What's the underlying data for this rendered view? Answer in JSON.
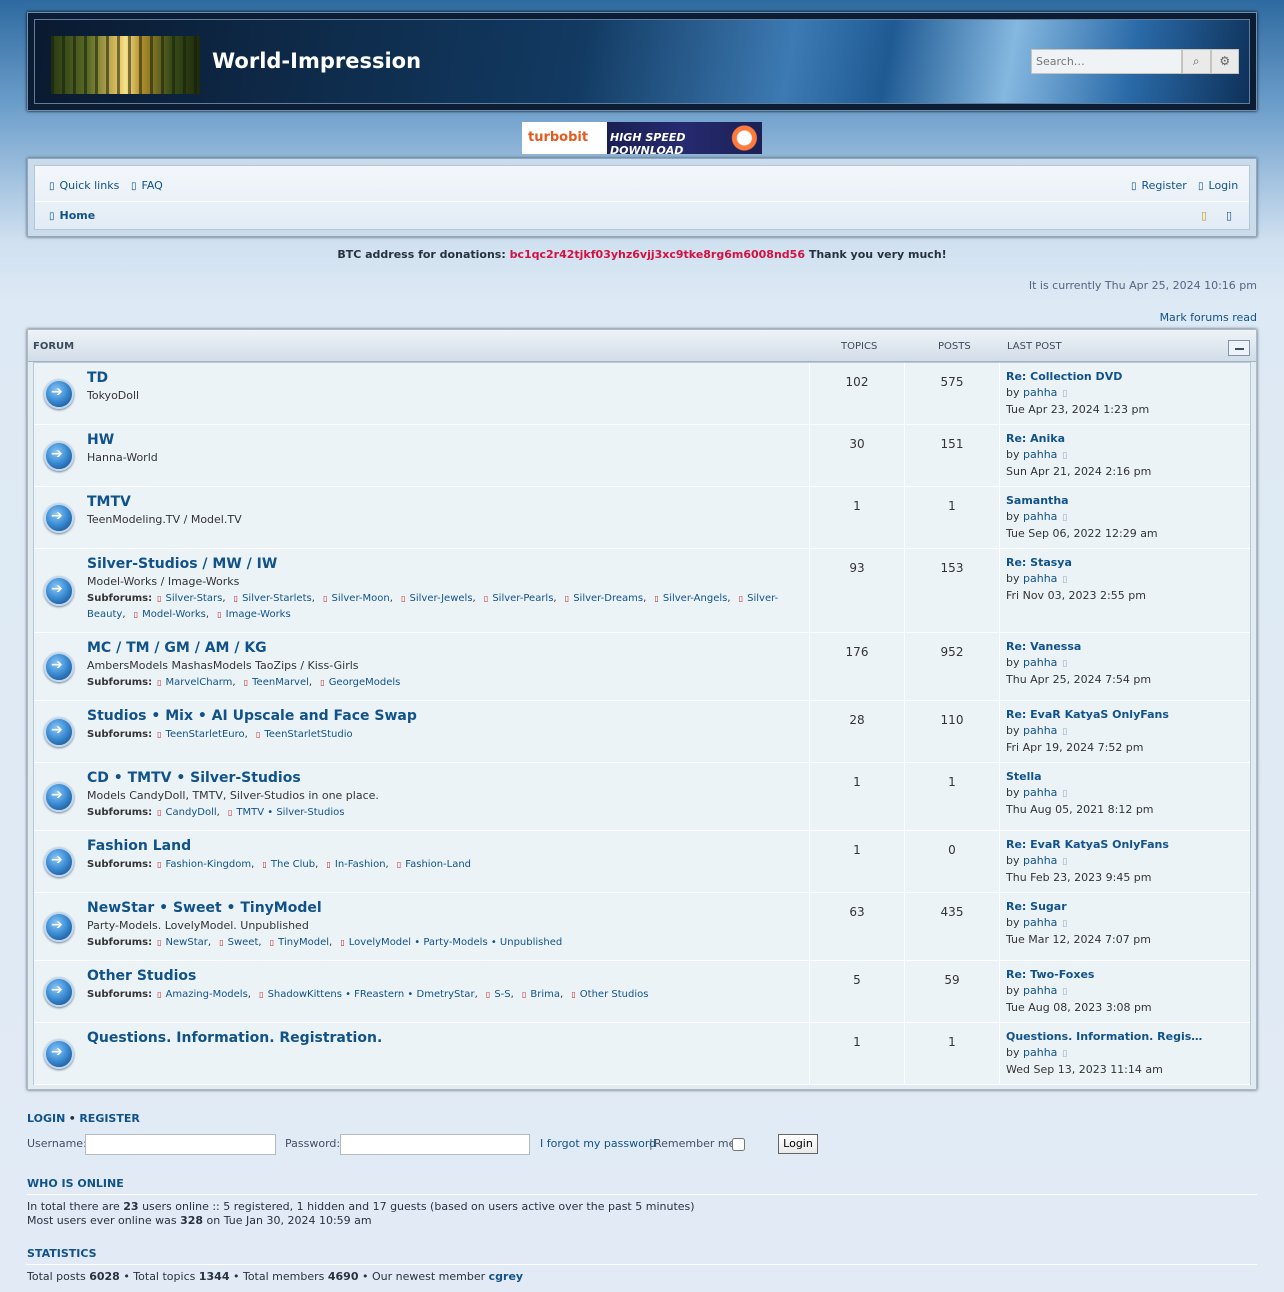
{
  "header": {
    "site_title": "World-Impression",
    "search_placeholder": "Search…",
    "search_icon": "magnifier",
    "advanced_icon": "gear"
  },
  "banner": {
    "brand": "turbobit",
    "text": "HIGH SPEED DOWNLOAD"
  },
  "nav": {
    "quick_links": "Quick links",
    "faq": "FAQ",
    "register": "Register",
    "login": "Login",
    "home": "Home"
  },
  "donation": {
    "prefix": "BTC address for donations:",
    "address": "bc1qc2r42tjkf03yhz6vjj3xc9tke8rg6m6008nd56",
    "suffix": "Thank you very much!"
  },
  "current_time": "It is currently Thu Apr 25, 2024 10:16 pm",
  "mark_read": "Mark forums read",
  "table_head": {
    "forum": "FORUM",
    "topics": "TOPICS",
    "posts": "POSTS",
    "last_post": "LAST POST"
  },
  "forums": [
    {
      "title": "TD",
      "desc": "TokyoDoll",
      "topics": "102",
      "posts": "575",
      "last_title": "Re: Collection DVD",
      "by": "by",
      "author": "pahha",
      "date": "Tue Apr 23, 2024 1:23 pm"
    },
    {
      "title": "HW",
      "desc": "Hanna-World",
      "topics": "30",
      "posts": "151",
      "last_title": "Re: Anika",
      "by": "by",
      "author": "pahha",
      "date": "Sun Apr 21, 2024 2:16 pm"
    },
    {
      "title": "TMTV",
      "desc": "TeenModeling.TV / Model.TV",
      "topics": "1",
      "posts": "1",
      "last_title": "Samantha",
      "by": "by",
      "author": "pahha",
      "date": "Tue Sep 06, 2022 12:29 am"
    },
    {
      "title": "Silver-Studios / MW / IW",
      "desc": "Model-Works / Image-Works",
      "subforums": [
        "Silver-Stars",
        "Silver-Starlets",
        "Silver-Moon",
        "Silver-Jewels",
        "Silver-Pearls",
        "Silver-Dreams",
        "Silver-Angels",
        "Silver-Beauty",
        "Model-Works",
        "Image-Works"
      ],
      "topics": "93",
      "posts": "153",
      "last_title": "Re: Stasya",
      "by": "by",
      "author": "pahha",
      "date": "Fri Nov 03, 2023 2:55 pm"
    },
    {
      "title": "MC / TM / GM / AM / KG",
      "desc": "AmbersModels MashasModels TaoZips / Kiss-Girls",
      "subforums": [
        "MarvelCharm",
        "TeenMarvel",
        "GeorgeModels"
      ],
      "topics": "176",
      "posts": "952",
      "last_title": "Re: Vanessa",
      "by": "by",
      "author": "pahha",
      "date": "Thu Apr 25, 2024 7:54 pm"
    },
    {
      "title": "Studios • Mix • AI Upscale and Face Swap",
      "desc": "",
      "subforums": [
        "TeenStarletEuro",
        "TeenStarletStudio"
      ],
      "topics": "28",
      "posts": "110",
      "last_title": "Re: EvaR KatyaS OnlyFans",
      "by": "by",
      "author": "pahha",
      "date": "Fri Apr 19, 2024 7:52 pm"
    },
    {
      "title": "CD • TMTV • Silver-Studios",
      "desc": "Models CandyDoll, TMTV, Silver-Studios in one place.",
      "subforums": [
        "CandyDoll",
        "TMTV • Silver-Studios"
      ],
      "topics": "1",
      "posts": "1",
      "last_title": "Stella",
      "by": "by",
      "author": "pahha",
      "date": "Thu Aug 05, 2021 8:12 pm"
    },
    {
      "title": "Fashion Land",
      "desc": "",
      "subforums": [
        "Fashion-Kingdom",
        "The Club",
        "In-Fashion",
        "Fashion-Land"
      ],
      "topics": "1",
      "posts": "0",
      "last_title": "Re: EvaR KatyaS OnlyFans",
      "by": "by",
      "author": "pahha",
      "date": "Thu Feb 23, 2023 9:45 pm"
    },
    {
      "title": "NewStar • Sweet • TinyModel",
      "desc": "Party-Models. LovelyModel. Unpublished",
      "subforums": [
        "NewStar",
        "Sweet",
        "TinyModel",
        "LovelyModel • Party-Models • Unpublished"
      ],
      "topics": "63",
      "posts": "435",
      "last_title": "Re: Sugar",
      "by": "by",
      "author": "pahha",
      "date": "Tue Mar 12, 2024 7:07 pm"
    },
    {
      "title": "Other Studios",
      "desc": "",
      "subforums": [
        "Amazing-Models",
        "ShadowKittens • FReastern • DmetryStar",
        "S-S",
        "Brima",
        "Other Studios"
      ],
      "topics": "5",
      "posts": "59",
      "last_title": "Re: Two-Foxes",
      "by": "by",
      "author": "pahha",
      "date": "Tue Aug 08, 2023 3:08 pm"
    },
    {
      "title": "Questions. Information. Registration.",
      "desc": "",
      "topics": "1",
      "posts": "1",
      "last_title": "Questions. Information. Regis…",
      "by": "by",
      "author": "pahha",
      "date": "Wed Sep 13, 2023 11:14 am"
    }
  ],
  "subforums_label": "Subforums:",
  "login_section": {
    "heading_login": "LOGIN",
    "sep": "•",
    "heading_register": "REGISTER",
    "username_label": "Username:",
    "password_label": "Password:",
    "forgot": "I forgot my password",
    "pipe": "|",
    "remember": "Remember me",
    "button": "Login"
  },
  "who_online": {
    "heading": "WHO IS ONLINE",
    "line1_a": "In total there are",
    "line1_count": "23",
    "line1_b": "users online :: 5 registered, 1 hidden and 17 guests (based on users active over the past 5 minutes)",
    "line2_a": "Most users ever online was",
    "line2_count": "328",
    "line2_b": "on Tue Jan 30, 2024 10:59 am"
  },
  "statistics": {
    "heading": "STATISTICS",
    "posts_label": "Total posts",
    "posts": "6028",
    "topics_label": "• Total topics",
    "topics": "1344",
    "members_label": "• Total members",
    "members": "4690",
    "newest_label": "• Our newest member",
    "newest": "cgrey"
  }
}
